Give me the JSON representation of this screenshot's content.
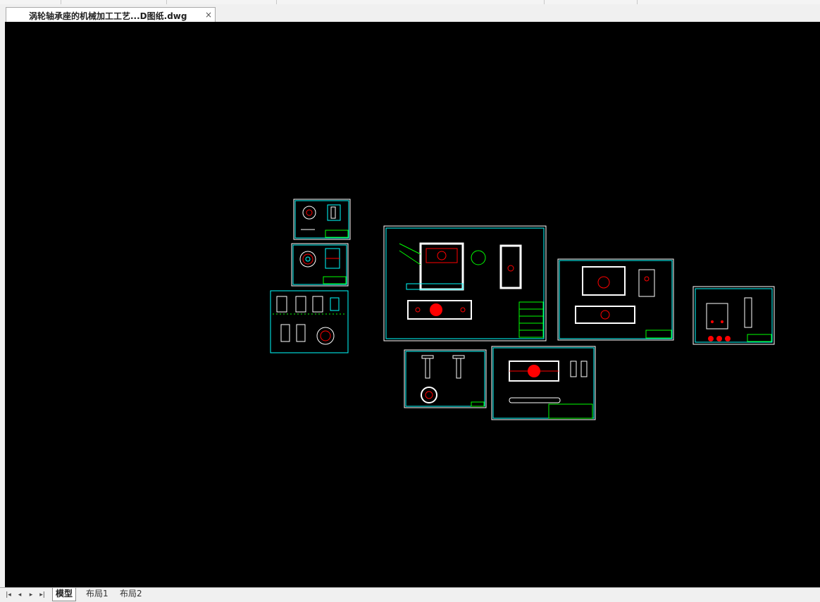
{
  "document_tab": {
    "title": "涡轮轴承座的机械加工工艺...D图纸.dwg",
    "close_label": "×"
  },
  "layout_nav": {
    "first": "|◂",
    "prev": "◂",
    "next": "▸",
    "last": "▸|"
  },
  "layout_tabs": [
    "模型",
    "布局1",
    "布局2"
  ],
  "colors": {
    "canvas_bg": "#000000",
    "frame": "#00ffff",
    "annotation": "#00ff00",
    "highlight": "#ff0000",
    "line": "#ffffff"
  }
}
